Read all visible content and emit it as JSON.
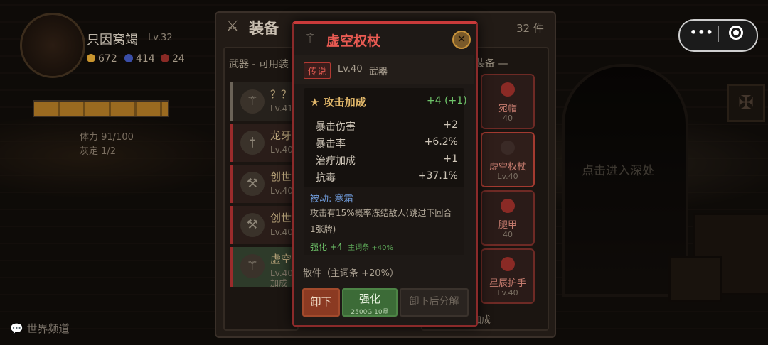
{
  "player": {
    "name": "只因窝竭",
    "level": "Lv.32",
    "gold": "672",
    "gems": "414",
    "keys": "24",
    "stamina": "体力 91/100",
    "stamina2": "灰定 1/2"
  },
  "world_channel": "世界频道",
  "scene": {
    "enter_hint": "点击进入深处"
  },
  "panel": {
    "title": "装备",
    "count": "32 件",
    "weapons_title": "武器 - 可用装",
    "equipped_title": "装备 —",
    "weapons": [
      {
        "name": "？？",
        "level": "Lv.41"
      },
      {
        "name": "龙牙",
        "level": "Lv.40"
      },
      {
        "name": "创世",
        "level": "Lv.40"
      },
      {
        "name": "创世",
        "level": "Lv.40"
      },
      {
        "name": "虚空",
        "level": "Lv.40",
        "extra": "加成"
      }
    ],
    "equipped": [
      {
        "name": "宛帽",
        "level": "40"
      },
      {
        "name": "虚空权杖",
        "level": "Lv.40"
      },
      {
        "name": "腿甲",
        "level": "40"
      },
      {
        "name": "星辰护手",
        "level": "Lv.40"
      }
    ],
    "bottom_note": "加成"
  },
  "modal": {
    "title": "虚空权杖",
    "rarity": "传说",
    "level": "Lv.40",
    "type": "武器",
    "main_stat": {
      "label": "★ 攻击加成",
      "value": "+4 (+1)"
    },
    "stats": [
      {
        "label": "暴击伤害",
        "value": "+2"
      },
      {
        "label": "暴击率",
        "value": "+6.2%"
      },
      {
        "label": "治疗加成",
        "value": "+1"
      },
      {
        "label": "抗毒",
        "value": "+37.1%"
      }
    ],
    "passive_title": "被动: 寒霜",
    "passive_desc": "攻击有15%概率冻结敌人(跳过下回合1张牌)",
    "enhance": "强化 +4",
    "enhance_note": "主词条 +40%",
    "loose": "散件（主词条 +20%）",
    "buttons": {
      "unequip": "卸下",
      "enhance": "强化",
      "enhance_cost": "2500G 10晶",
      "unequip_decompose": "卸下后分解"
    }
  },
  "capsule": {
    "more": "•••"
  },
  "colors": {
    "legendary": "#e85a52",
    "positive": "#6fc56a",
    "gold": "#e2b86a"
  }
}
